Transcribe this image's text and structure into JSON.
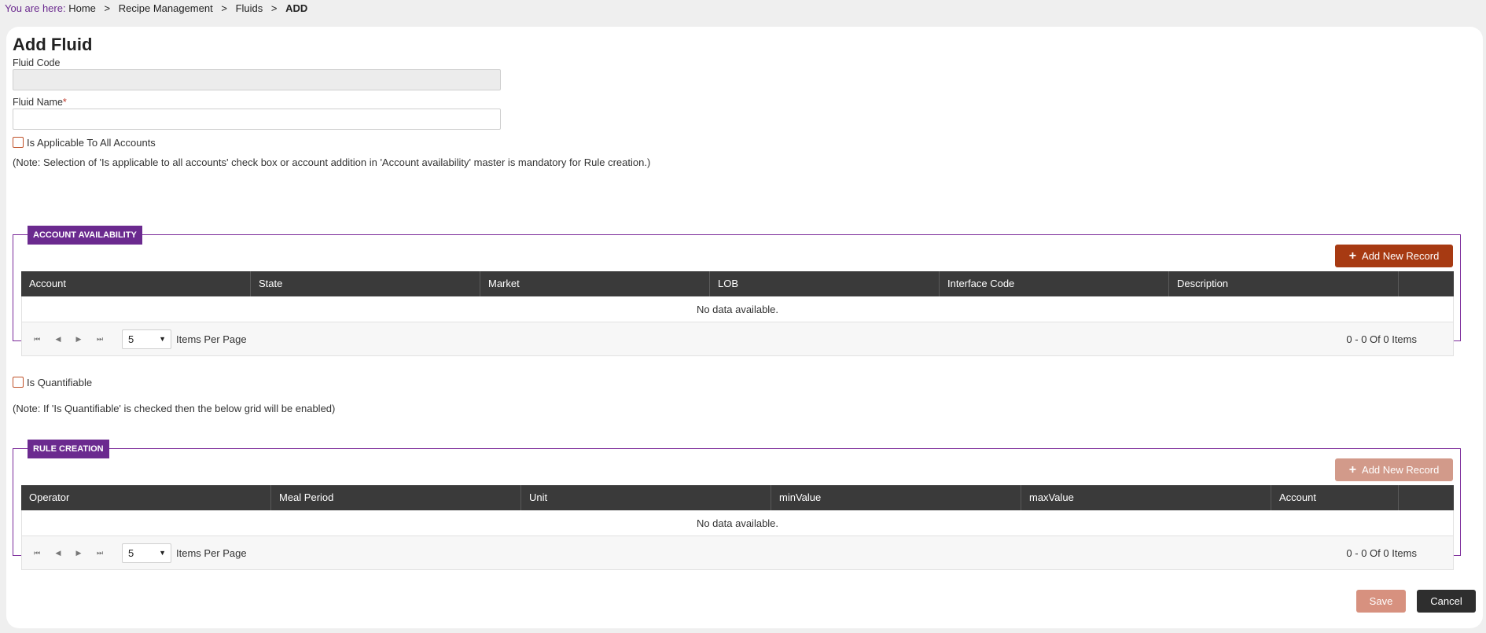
{
  "breadcrumb": {
    "lead": "You are here:",
    "separator": ">",
    "items": [
      "Home",
      "Recipe Management",
      "Fluids"
    ],
    "current": "ADD"
  },
  "page": {
    "title": "Add Fluid"
  },
  "form": {
    "fluid_code": {
      "label": "Fluid Code",
      "value": ""
    },
    "fluid_name": {
      "label": "Fluid Name",
      "required_marker": "*",
      "value": ""
    },
    "applicable_all": {
      "label": "Is Applicable To All Accounts",
      "checked": false
    },
    "note_accounts": "(Note: Selection of 'Is applicable to all accounts' check box or account addition in 'Account availability' master is mandatory for Rule creation.)",
    "quantifiable": {
      "label": "Is Quantifiable",
      "checked": false
    },
    "note_quantifiable": "(Note: If 'Is Quantifiable' is checked then the below grid will be enabled)"
  },
  "account_availability": {
    "tag": "ACCOUNT AVAILABILITY",
    "add_button": "Add New Record",
    "columns": [
      "Account",
      "State",
      "Market",
      "LOB",
      "Interface Code",
      "Description",
      ""
    ],
    "empty_text": "No data available.",
    "pager": {
      "page_size": "5",
      "items_per_page_label": "Items Per Page",
      "info": "0 - 0 Of 0 Items"
    }
  },
  "rule_creation": {
    "tag": "RULE CREATION",
    "add_button": "Add New Record",
    "columns": [
      "Operator",
      "Meal Period",
      "Unit",
      "minValue",
      "maxValue",
      "Account",
      ""
    ],
    "empty_text": "No data available.",
    "pager": {
      "page_size": "5",
      "items_per_page_label": "Items Per Page",
      "info": "0 - 0 Of 0 Items"
    }
  },
  "actions": {
    "save": "Save",
    "cancel": "Cancel"
  },
  "icons": {
    "first": "first-page-icon",
    "prev": "prev-page-icon",
    "next": "next-page-icon",
    "last": "last-page-icon",
    "caret": "chevron-down-icon",
    "plus": "plus-icon"
  },
  "colors": {
    "accent_purple": "#6b2a8f",
    "add_button": "#a73a12",
    "add_button_disabled": "#d29a8a",
    "grid_header": "#3a3a3a",
    "save_disabled": "#d7917f",
    "cancel": "#2e2e2e"
  }
}
